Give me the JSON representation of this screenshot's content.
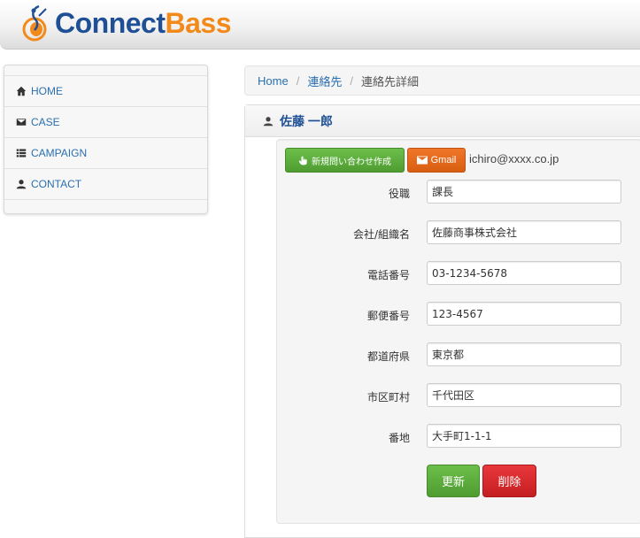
{
  "app": {
    "logo_connect": "Connect",
    "logo_bass": "Bass"
  },
  "sidebar": {
    "items": [
      {
        "label": "HOME",
        "icon": "home-icon"
      },
      {
        "label": "CASE",
        "icon": "envelope-icon"
      },
      {
        "label": "CAMPAIGN",
        "icon": "list-icon"
      },
      {
        "label": "CONTACT",
        "icon": "user-icon"
      }
    ]
  },
  "breadcrumb": {
    "home": "Home",
    "contacts": "連絡先",
    "current": "連絡先詳細",
    "separator": "/"
  },
  "contact": {
    "name": "佐藤 一郎",
    "new_inquiry_label": "新規問い合わせ作成",
    "gmail_label": "Gmail",
    "email": "ichiro@xxxx.co.jp"
  },
  "fields": [
    {
      "label": "役職",
      "value": "課長"
    },
    {
      "label": "会社/組織名",
      "value": "佐藤商事株式会社"
    },
    {
      "label": "電話番号",
      "value": "03-1234-5678"
    },
    {
      "label": "郵便番号",
      "value": "123-4567"
    },
    {
      "label": "都道府県",
      "value": "東京都"
    },
    {
      "label": "市区町村",
      "value": "千代田区"
    },
    {
      "label": "番地",
      "value": "大手町1-1-1"
    }
  ],
  "actions": {
    "update_label": "更新",
    "delete_label": "削除"
  },
  "colors": {
    "brand_blue": "#1f4f95",
    "brand_orange": "#f28a1b",
    "link": "#2a6fb0",
    "success": "#5cb53d",
    "danger": "#d9282b",
    "warning": "#e8691f"
  }
}
